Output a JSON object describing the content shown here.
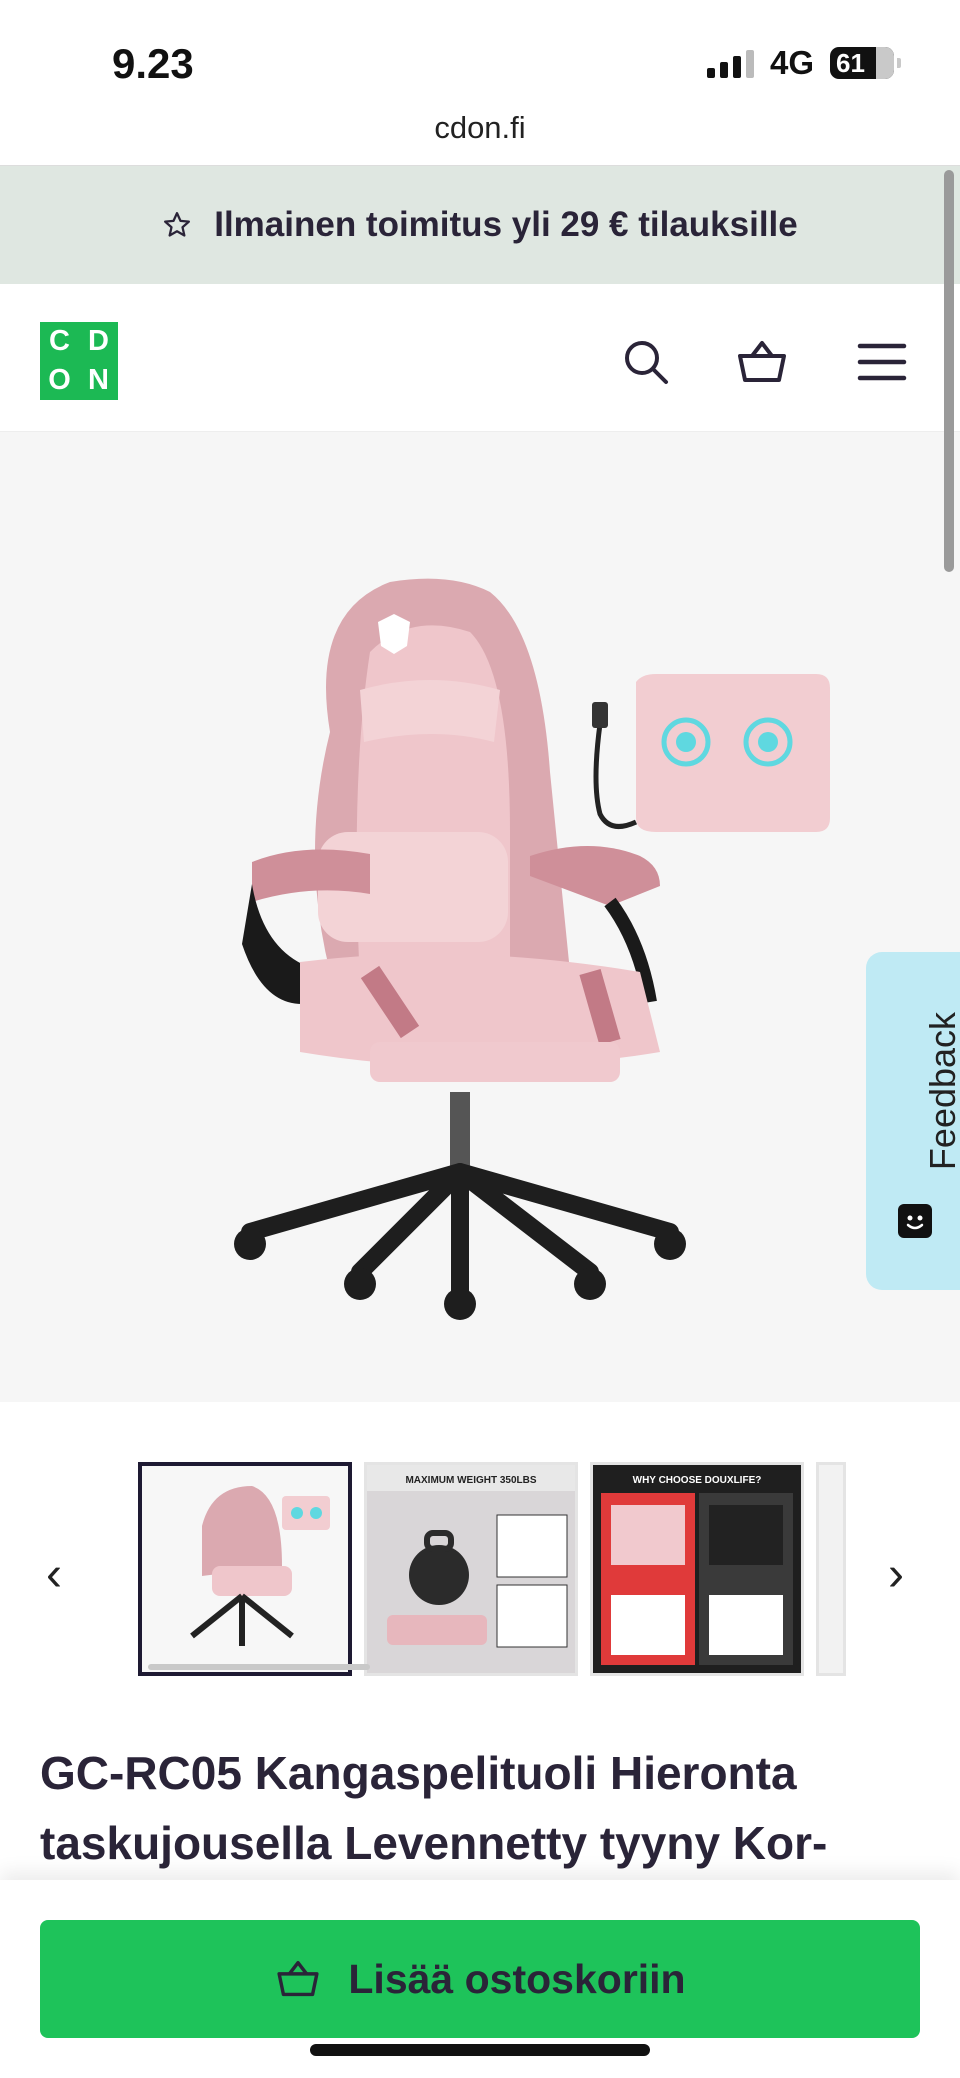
{
  "status_bar": {
    "time": "9.23",
    "network": "4G",
    "battery": "61"
  },
  "browser": {
    "url": "cdon.fi"
  },
  "promo": {
    "icon": "star-icon",
    "text": "Ilmainen toimitus yli 29 € tilauksille"
  },
  "header": {
    "logo_letters": [
      "C",
      "D",
      "O",
      "N"
    ],
    "icons": [
      "search-icon",
      "basket-icon",
      "menu-icon"
    ],
    "brand_color": "#1cb954"
  },
  "gallery": {
    "feedback_label": "Feedback",
    "zoom_icon": "zoom-in-icon",
    "background": "#f6f6f6"
  },
  "thumbnails": {
    "prev_label": "‹",
    "next_label": "›",
    "items": [
      {
        "name": "thumb-chair-main",
        "caption": ""
      },
      {
        "name": "thumb-max-weight",
        "caption": "MAXIMUM WEIGHT 350LBS"
      },
      {
        "name": "thumb-why-choose",
        "caption": "WHY CHOOSE DOUXLIFE?"
      }
    ]
  },
  "product": {
    "title": "GC-RC05 Kangaspelituoli Hieronta taskujousella Levennetty tyyny Kor-"
  },
  "cart_bar": {
    "button_label": "Lisää ostoskoriin",
    "button_color": "#1ec35a"
  }
}
